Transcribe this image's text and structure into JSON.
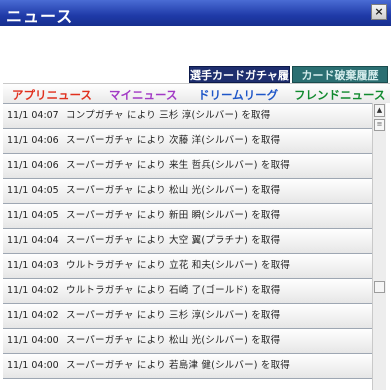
{
  "window": {
    "title": "ニュース",
    "close_label": "×"
  },
  "subtabs": [
    {
      "label": "選手カードガチャ履歴"
    },
    {
      "label": "カード破棄履歴"
    }
  ],
  "tabs": [
    {
      "label": "アプリニュース"
    },
    {
      "label": "マイニュース"
    },
    {
      "label": "ドリームリーグ"
    },
    {
      "label": "フレンドニュース"
    }
  ],
  "scrollbar": {
    "up_icon": "▲",
    "thumb_icon": "≡"
  },
  "news": [
    {
      "time": "11/1 04:07",
      "text": "コンプガチャ により 三杉 淳(シルバー) を取得"
    },
    {
      "time": "11/1 04:06",
      "text": "スーパーガチャ により 次藤 洋(シルバー) を取得"
    },
    {
      "time": "11/1 04:06",
      "text": "スーパーガチャ により 来生 哲兵(シルバー) を取得"
    },
    {
      "time": "11/1 04:05",
      "text": "スーパーガチャ により 松山 光(シルバー) を取得"
    },
    {
      "time": "11/1 04:05",
      "text": "スーパーガチャ により 新田 瞬(シルバー) を取得"
    },
    {
      "time": "11/1 04:04",
      "text": "スーパーガチャ により 大空 翼(プラチナ) を取得"
    },
    {
      "time": "11/1 04:03",
      "text": "ウルトラガチャ により 立花 和夫(シルバー) を取得"
    },
    {
      "time": "11/1 04:02",
      "text": "ウルトラガチャ により 石崎 了(ゴールド) を取得"
    },
    {
      "time": "11/1 04:02",
      "text": "スーパーガチャ により 三杉 淳(シルバー) を取得"
    },
    {
      "time": "11/1 04:00",
      "text": "スーパーガチャ により 松山 光(シルバー) を取得"
    },
    {
      "time": "11/1 04:00",
      "text": "スーパーガチャ により 若島津 健(シルバー) を取得"
    }
  ]
}
